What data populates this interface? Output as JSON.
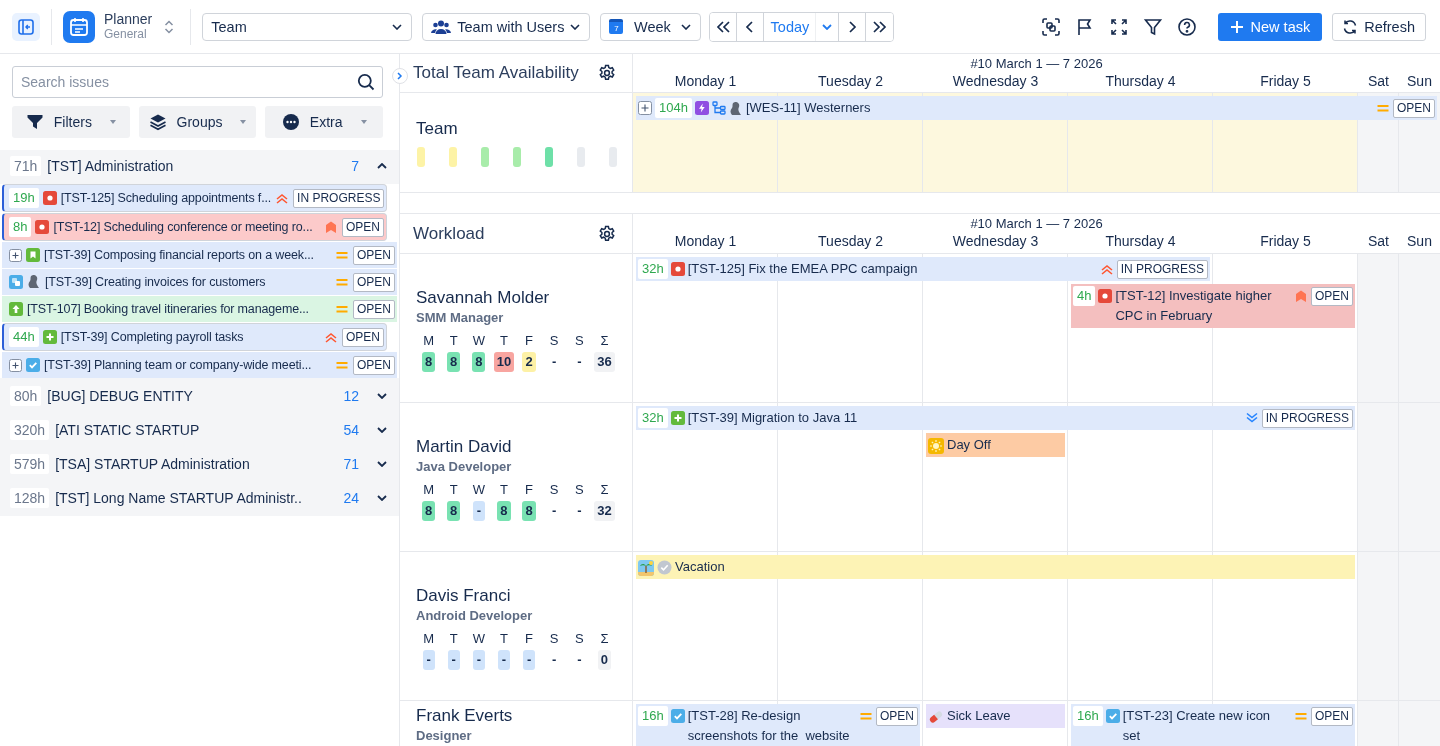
{
  "toolbar": {
    "app": {
      "title": "Planner",
      "subtitle": "General"
    },
    "view_select": {
      "value": "Team"
    },
    "mode_select": {
      "value": "Team with Users"
    },
    "period_select": {
      "value": "Week",
      "date_badge": "7"
    },
    "today": "Today",
    "new_task": "New task",
    "refresh": "Refresh"
  },
  "sidebar": {
    "search": {
      "placeholder": "Search issues"
    },
    "buttons": [
      {
        "label": "Filters",
        "kind": "filters"
      },
      {
        "label": "Groups",
        "kind": "groups"
      },
      {
        "label": "Extra",
        "kind": "extra"
      }
    ],
    "groups": [
      {
        "hours": "71h",
        "title": "[TST] Administration",
        "count": "7",
        "expanded": true,
        "items": [
          {
            "hours": "19h",
            "expandable": false,
            "kind": "bug",
            "has_avatar": false,
            "title": "[TST-125] Scheduling appointments f...",
            "status": "IN PROGRESS",
            "selected": true,
            "color": "#dfe9fb"
          },
          {
            "hours": "8h",
            "expandable": false,
            "kind": "bug",
            "has_avatar": false,
            "title": "[TST-12] Scheduling conference or meeting ro...",
            "status": "OPEN",
            "selected": true,
            "color": "#fccaca"
          },
          {
            "expandable": true,
            "kind": "story",
            "has_avatar": false,
            "title": "[TST-39] Composing financial reports on a week...",
            "status": "OPEN",
            "selected": false,
            "color": "#dfe9fb"
          },
          {
            "expandable": false,
            "kind": "subtask",
            "has_avatar": true,
            "title": "[TST-39] Creating invoices for customers",
            "status": "OPEN",
            "selected": false,
            "color": "#dfe9fb"
          },
          {
            "expandable": false,
            "kind": "improvement",
            "has_avatar": false,
            "title": "[TST-107] Booking travel itineraries for manageme...",
            "status": "OPEN",
            "selected": false,
            "color": "#daf5e3"
          },
          {
            "hours": "44h",
            "expandable": false,
            "kind": "new-feature",
            "has_avatar": false,
            "title": "[TST-39] Completing payroll tasks",
            "status": "OPEN",
            "selected": true,
            "color": "#dfe9fb"
          },
          {
            "expandable": true,
            "kind": "task",
            "has_avatar": false,
            "title": "[TST-39] Planning team or company-wide meeti...",
            "status": "OPEN",
            "selected": false,
            "color": "#dfe9fb"
          }
        ]
      },
      {
        "hours": "80h",
        "title": "[BUG] DEBUG ENTITY",
        "count": "12",
        "expanded": false
      },
      {
        "hours": "320h",
        "title": "[ATI STATIC STARTUP",
        "count": "54",
        "expanded": false
      },
      {
        "hours": "579h",
        "title": "[TSA] STARTUP Administration",
        "count": "71",
        "expanded": false
      },
      {
        "hours": "128h",
        "title": "[TST] Long Name STARTUP Administr..",
        "count": "24",
        "expanded": false
      }
    ]
  },
  "sections": [
    {
      "kind": "availability",
      "title": "Total Team Availability",
      "week": "#10 March 1 — 7 2026",
      "days": [
        {
          "label": "Monday 1",
          "weekend": false
        },
        {
          "label": "Tuesday 2",
          "weekend": false
        },
        {
          "label": "Wednesday 3",
          "weekend": false
        },
        {
          "label": "Thursday 4",
          "weekend": false
        },
        {
          "label": "Friday 5",
          "weekend": false
        },
        {
          "label": "Sat",
          "weekend": true
        },
        {
          "label": "Sun",
          "weekend": true
        }
      ],
      "rows": [
        {
          "name": "Team",
          "bars": [
            {
              "color": "#fdf3a6"
            },
            {
              "color": "#fdf3a6"
            },
            {
              "color": "#a8ecaa"
            },
            {
              "color": "#a8ecaa"
            },
            {
              "color": "#6ee0a8"
            },
            {
              "color": "#e8ebef"
            },
            {
              "color": "#e8ebef"
            }
          ],
          "lanes": [
            [
              {
                "kind": "task",
                "color": "#dfe9fb",
                "expandable": true,
                "hours": "104h",
                "hierarchy": true,
                "has_avatar": true,
                "title": "[WES-11] Westerners",
                "status": "OPEN"
              }
            ]
          ]
        }
      ]
    },
    {
      "kind": "workload",
      "title": "Workload",
      "week": "#10 March 1 — 7 2026",
      "days": [
        {
          "label": "Monday 1",
          "weekend": false
        },
        {
          "label": "Tuesday 2",
          "weekend": false
        },
        {
          "label": "Wednesday 3",
          "weekend": false
        },
        {
          "label": "Thursday 4",
          "weekend": false
        },
        {
          "label": "Friday 5",
          "weekend": false
        },
        {
          "label": "Sat",
          "weekend": true
        },
        {
          "label": "Sun",
          "weekend": true
        }
      ],
      "rows": [
        {
          "name": "Savannah Molder",
          "role": "SMM Manager",
          "total_label": "Σ",
          "total": "36",
          "days": [
            {
              "label": "M",
              "value": "8",
              "kind": "ok"
            },
            {
              "label": "T",
              "value": "8",
              "kind": "ok"
            },
            {
              "label": "W",
              "value": "8",
              "kind": "ok"
            },
            {
              "label": "T",
              "value": "10",
              "kind": "over"
            },
            {
              "label": "F",
              "value": "2",
              "kind": "under"
            },
            {
              "label": "S",
              "value": "-",
              "kind": "none"
            },
            {
              "label": "S",
              "value": "-",
              "kind": "none"
            }
          ],
          "lanes": [
            [
              {
                "kind": "task",
                "color": "#dfe9fb",
                "expandable": false,
                "hours": "32h",
                "hierarchy": false,
                "has_avatar": false,
                "title": "[TST-125] Fix the EMEA PPC campaign",
                "status": "IN PROGRESS"
              }
            ],
            [
              {
                "kind": "task",
                "color": "#f4bfbf",
                "expandable": false,
                "hours": "4h",
                "hierarchy": false,
                "has_avatar": false,
                "title": "[TST-12] Investigate higher CPC in February",
                "status": "OPEN"
              }
            ]
          ]
        },
        {
          "name": "Martin David",
          "role": "Java Developer",
          "total_label": "Σ",
          "total": "32",
          "days": [
            {
              "label": "M",
              "value": "8",
              "kind": "ok"
            },
            {
              "label": "T",
              "value": "8",
              "kind": "ok"
            },
            {
              "label": "W",
              "value": "-",
              "kind": "off"
            },
            {
              "label": "T",
              "value": "8",
              "kind": "ok"
            },
            {
              "label": "F",
              "value": "8",
              "kind": "ok"
            },
            {
              "label": "S",
              "value": "-",
              "kind": "none"
            },
            {
              "label": "S",
              "value": "-",
              "kind": "none"
            }
          ],
          "lanes": [
            [
              {
                "kind": "task",
                "color": "#dfe9fb",
                "expandable": false,
                "hours": "32h",
                "hierarchy": false,
                "has_avatar": false,
                "title": "[TST-39] Migration to Java 11",
                "status": "IN PROGRESS"
              }
            ],
            [
              {
                "kind": "absence",
                "color": "#fdcba4",
                "approved": false,
                "title": "Day Off"
              }
            ]
          ]
        },
        {
          "name": "Davis Franci",
          "role": "Android Developer",
          "total_label": "Σ",
          "total": "0",
          "days": [
            {
              "label": "M",
              "value": "-",
              "kind": "off"
            },
            {
              "label": "T",
              "value": "-",
              "kind": "off"
            },
            {
              "label": "W",
              "value": "-",
              "kind": "off"
            },
            {
              "label": "T",
              "value": "-",
              "kind": "off"
            },
            {
              "label": "F",
              "value": "-",
              "kind": "off"
            },
            {
              "label": "S",
              "value": "-",
              "kind": "none"
            },
            {
              "label": "S",
              "value": "-",
              "kind": "none"
            }
          ],
          "lanes": [
            [
              {
                "kind": "absence",
                "color": "#fdf3b5",
                "approved": true,
                "title": "Vacation"
              }
            ]
          ]
        },
        {
          "name": "Frank Everts",
          "role": "Designer",
          "lanes": [
            [
              {
                "kind": "task",
                "color": "#dfe9fb",
                "expandable": false,
                "hours": "16h",
                "hierarchy": false,
                "has_avatar": false,
                "title": "[TST-28] Re-design screenshots for the  website",
                "status": "OPEN"
              },
              {
                "kind": "absence",
                "color": "#e6e1fb",
                "approved": false,
                "title": "Sick Leave"
              },
              {
                "kind": "task",
                "color": "#dfe9fb",
                "expandable": false,
                "hours": "16h",
                "hierarchy": false,
                "has_avatar": false,
                "title": "[TST-23] Create new icon set",
                "status": "OPEN"
              }
            ]
          ]
        }
      ]
    }
  ]
}
